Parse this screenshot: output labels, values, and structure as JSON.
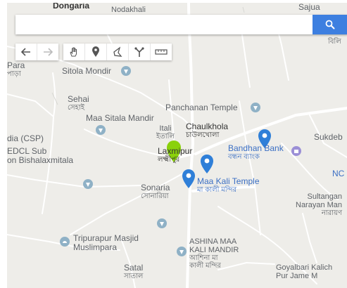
{
  "search": {
    "placeholder": "",
    "value": ""
  },
  "toolbar": {
    "history": [
      "undo-icon",
      "redo-icon"
    ],
    "tools": [
      "pan-hand-icon",
      "marker-icon",
      "polygon-icon",
      "route-icon",
      "measure-ruler-icon"
    ]
  },
  "labels": {
    "dongaria": "Dongaria",
    "nodakhali": "Nodakhali",
    "sajua": "Sajua",
    "sajua_bn": "বিলি",
    "para": "Para",
    "para_bn": "পাড়া",
    "sitola_mondir": "Sitola Mondir",
    "sehai": "Sehai",
    "sehai_bn": "সেহাই",
    "maa_sitala_mandir": "Maa Sitala Mandir",
    "itali": "Itali",
    "itali_bn": "ইতালি",
    "panchanan_temple": "Panchanan Temple",
    "chaulkhola": "Chaulkhola",
    "chaulkhola_bn": "চাউলখোলা",
    "bandhan_bank": "Bandhan Bank",
    "bandhan_bank_bn": "বন্ধন ব্যাংক",
    "sukdeb": "Sukdeb",
    "csp": "dia (CSP)",
    "sedcl_sub": "EDCL Sub",
    "bishalaxmitala": "on Bishalaxmitala",
    "laxmipur": "Laxmipur",
    "laxmipur_bn": "লক্ষ্মীপুর",
    "nc": "NC I",
    "sonaria": "Sonaria",
    "sonaria_bn": "সোনারিয়া",
    "maa_kali_temple": "Maa Kali Temple",
    "maa_kali_temple_bn": "মা কালী মন্দির",
    "sultanganj": "Sultangan",
    "narayan_man": "Narayan Man",
    "narayan_bn": "নারায়ণ",
    "tripurapur_masjid": "Tripurapur Masjid",
    "muslimpara": "Muslimpara",
    "ashina_maa": "ASHINA MAA",
    "kali_mandir": "KALI MANDIR",
    "ashina_bn1": "আশিনা মা",
    "ashina_bn2": "কালী মন্দির",
    "satal": "Satal",
    "satal_bn": "সাতাল",
    "goyalbari": "Goyalbari Kalich",
    "pur_jame": "Pur Jame M"
  },
  "colors": {
    "map_background": "#eeede9",
    "search_button": "#3d7fe0",
    "blue_marker": "#2f7fd8",
    "green_marker": "#8ad10b",
    "poi_icon": "#8fb1c6",
    "poi_text": "#3f8c4e"
  },
  "markers": {
    "selected": "green-location-pin-icon",
    "results": [
      "blue-location-pin-icon",
      "blue-location-pin-icon",
      "blue-location-pin-icon"
    ]
  }
}
